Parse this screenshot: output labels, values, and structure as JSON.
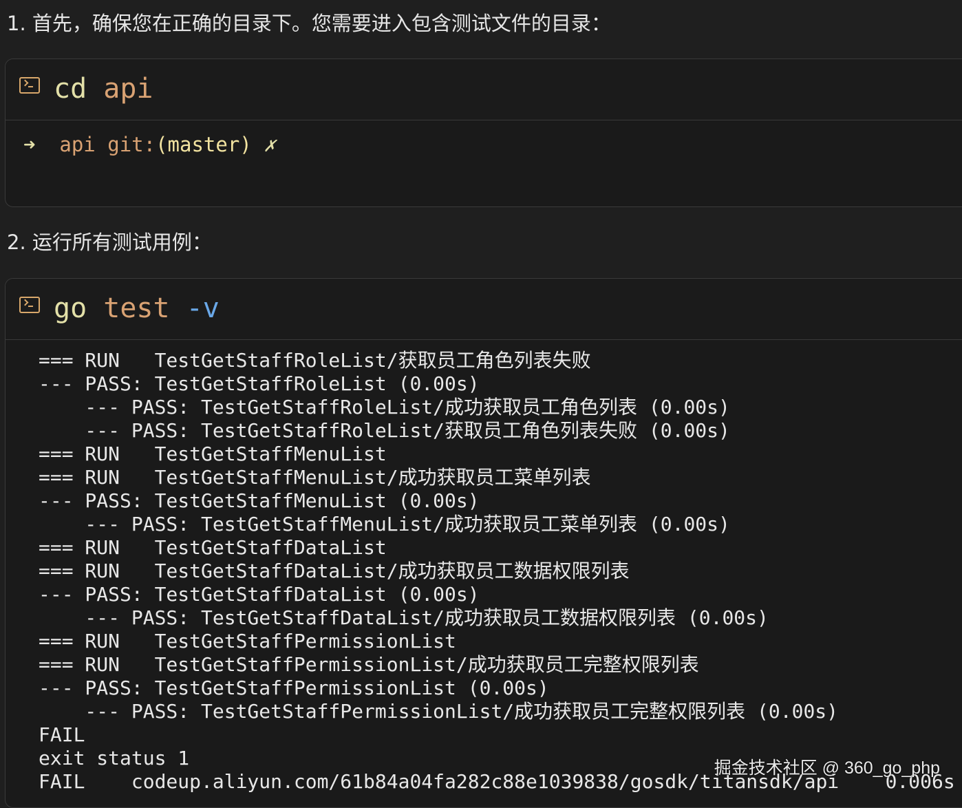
{
  "step1": "1. 首先，确保您在正确的目录下。您需要进入包含测试文件的目录：",
  "terminal1": {
    "icon": "terminal-icon",
    "cmd": {
      "w1": "cd",
      "w2": "api"
    },
    "prompt": {
      "arrow": "➜",
      "dir": "api",
      "git": "git:",
      "branch": "(master)",
      "x": "✗"
    }
  },
  "step2": "2. 运行所有测试用例：",
  "terminal2": {
    "icon": "terminal-icon",
    "cmd": {
      "w1": "go",
      "w2": "test",
      "w3": "-v"
    },
    "output": [
      "=== RUN   TestGetStaffRoleList/获取员工角色列表失败",
      "--- PASS: TestGetStaffRoleList (0.00s)",
      "    --- PASS: TestGetStaffRoleList/成功获取员工角色列表 (0.00s)",
      "    --- PASS: TestGetStaffRoleList/获取员工角色列表失败 (0.00s)",
      "=== RUN   TestGetStaffMenuList",
      "=== RUN   TestGetStaffMenuList/成功获取员工菜单列表",
      "--- PASS: TestGetStaffMenuList (0.00s)",
      "    --- PASS: TestGetStaffMenuList/成功获取员工菜单列表 (0.00s)",
      "=== RUN   TestGetStaffDataList",
      "=== RUN   TestGetStaffDataList/成功获取员工数据权限列表",
      "--- PASS: TestGetStaffDataList (0.00s)",
      "    --- PASS: TestGetStaffDataList/成功获取员工数据权限列表 (0.00s)",
      "=== RUN   TestGetStaffPermissionList",
      "=== RUN   TestGetStaffPermissionList/成功获取员工完整权限列表",
      "--- PASS: TestGetStaffPermissionList (0.00s)",
      "    --- PASS: TestGetStaffPermissionList/成功获取员工完整权限列表 (0.00s)",
      "FAIL",
      "exit status 1",
      "FAIL    codeup.aliyun.com/61b84a04fa282c88e1039838/gosdk/titansdk/api    0.006s"
    ]
  },
  "watermark": "掘金技术社区 @ 360_go_php"
}
